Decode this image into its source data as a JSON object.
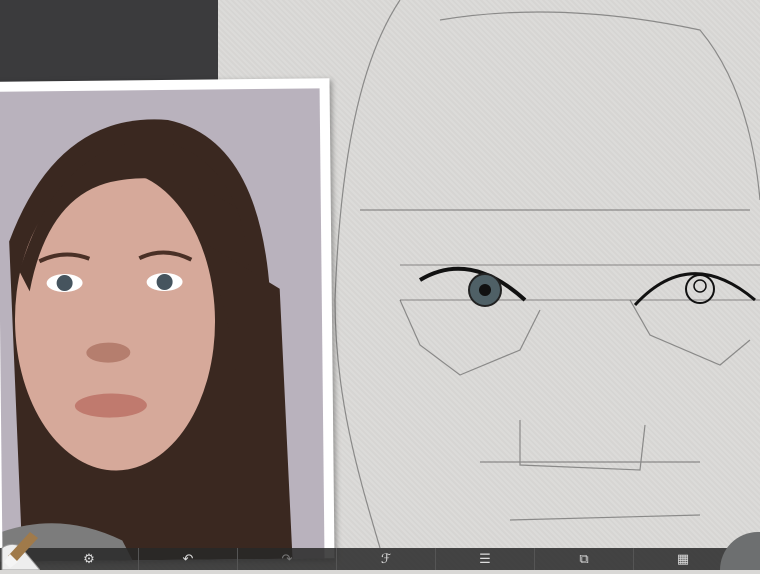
{
  "toolbar": {
    "icons": [
      "settings-icon",
      "undo-icon",
      "redo-icon",
      "brush-library-icon",
      "layers-icon",
      "export-icon",
      "gallery-icon"
    ]
  },
  "colors": {
    "toolbar": "#2b2b2b",
    "canvas": "#d9d8d6",
    "puck": "#6d6f70"
  }
}
